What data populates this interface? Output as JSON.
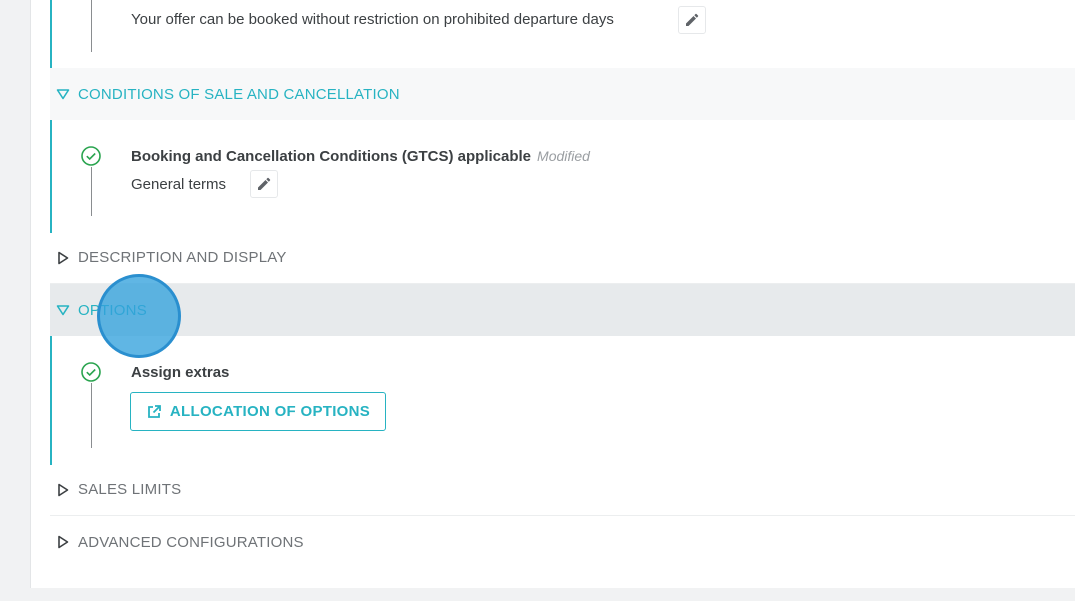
{
  "sections": {
    "departure": {
      "subtext": "Your offer can be booked without restriction on prohibited departure days"
    },
    "conditions": {
      "header": "CONDITIONS OF SALE AND CANCELLATION",
      "item_title": "Booking and Cancellation Conditions (GTCS) applicable",
      "item_badge": "Modified",
      "item_subtext": "General terms"
    },
    "description": {
      "header": "DESCRIPTION AND DISPLAY"
    },
    "options": {
      "header": "OPTIONS",
      "item_title": "Assign extras",
      "button_label": "ALLOCATION OF OPTIONS"
    },
    "sales_limits": {
      "header": "SALES LIMITS"
    },
    "advanced": {
      "header": "ADVANCED CONFIGURATIONS"
    }
  },
  "colors": {
    "accent": "#27b3c2",
    "check_green": "#2aa44f",
    "cursor": "#33a1dc"
  },
  "icons": {
    "open_caret": "caret-down-icon",
    "closed_caret": "caret-right-icon",
    "check": "check-circle-icon",
    "edit": "pencil-icon",
    "external": "external-link-icon"
  }
}
